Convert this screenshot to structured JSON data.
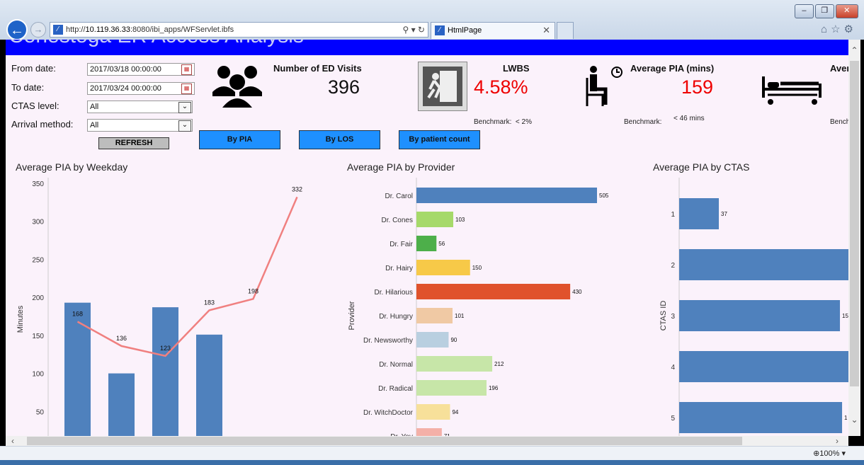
{
  "browser": {
    "url_prefix": "http://",
    "url_host": "10.119.36.33",
    "url_path": ":8080/ibi_apps/WFServlet.ibfs",
    "tab_title": "HtmlPage",
    "zoom": "100%"
  },
  "banner": {
    "title": "Conestoga ER Access Analysis"
  },
  "filters": {
    "from_label": "From date:",
    "from_value": "2017/03/18 00:00:00",
    "to_label": "To date:",
    "to_value": "2017/03/24 00:00:00",
    "ctas_label": "CTAS level:",
    "ctas_value": "All",
    "arrival_label": "Arrival method:",
    "arrival_value": "All",
    "refresh_label": "REFRESH"
  },
  "view_buttons": {
    "by_pia": "By PIA",
    "by_los": "By LOS",
    "by_count": "By patient count"
  },
  "kpis": {
    "visits": {
      "title": "Number of ED Visits",
      "value": "396"
    },
    "lwbs": {
      "title": "LWBS",
      "value": "4.58%",
      "bench_label": "Benchmark:",
      "bench_value": "< 2%"
    },
    "pia": {
      "title": "Average PIA (mins)",
      "value": "159",
      "bench_label": "Benchmark:",
      "bench_value": "< 46 mins"
    },
    "los": {
      "title": "Aver",
      "bench_label": "Bench"
    }
  },
  "colors": {
    "bar_blue": "#4f81bd",
    "line_red": "#f08080",
    "kpi_red": "#ee0000",
    "banner_blue": "#0000ff"
  },
  "chart_data": [
    {
      "type": "bar",
      "title": "Average PIA by Weekday",
      "ylabel": "Minutes",
      "ylim": [
        0,
        350
      ],
      "yticks": [
        50,
        100,
        150,
        200,
        250,
        300,
        350
      ],
      "bar_values": [
        193,
        100,
        187,
        151,
        null,
        null,
        null
      ],
      "series": [
        {
          "type": "line",
          "values": [
            168,
            136,
            123,
            183,
            198,
            332
          ]
        }
      ],
      "grid": false
    },
    {
      "type": "bar",
      "orientation": "horizontal",
      "title": "Average PIA by Provider",
      "ylabel": "Provider",
      "categories": [
        "Dr. Carol",
        "Dr. Cones",
        "Dr. Fair",
        "Dr. Hairy",
        "Dr. Hilarious",
        "Dr. Hungry",
        "Dr. Newsworthy",
        "Dr. Normal",
        "Dr. Radical",
        "Dr. WitchDoctor",
        "Dr. Yoy"
      ],
      "values": [
        505,
        103,
        56,
        150,
        430,
        101,
        90,
        212,
        196,
        94,
        71
      ],
      "colors": [
        "#4f81bd",
        "#a6d96a",
        "#4daf4a",
        "#f7c948",
        "#e0522c",
        "#f0c9a4",
        "#b9cfe0",
        "#c7e6a8",
        "#c7e6a8",
        "#f7e09a",
        "#f4b0a8"
      ]
    },
    {
      "type": "bar",
      "orientation": "horizontal",
      "title": "Average PIA by CTAS",
      "ylabel": "CTAS ID",
      "categories": [
        "1",
        "2",
        "3",
        "4",
        "5"
      ],
      "values": [
        37,
        160,
        150,
        160,
        152
      ],
      "value_labels": [
        "37",
        "",
        "15",
        "",
        "1"
      ]
    }
  ]
}
